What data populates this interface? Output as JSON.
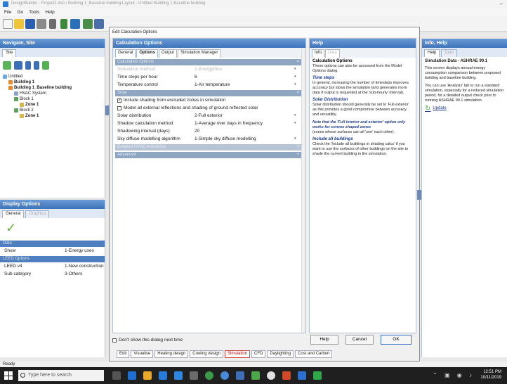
{
  "window": {
    "title": "DesignBuilder - Project1.dsb / Building 1_Baseline building Layout - Untitled Building 1 Baseline building"
  },
  "menu": [
    "File",
    "Go",
    "Tools",
    "Help"
  ],
  "navigate": {
    "title": "Navigate, Site",
    "tab": "Site",
    "tree": [
      {
        "label": "Untitled",
        "level": 0,
        "bold": false
      },
      {
        "label": "Building 1",
        "level": 1,
        "bold": true
      },
      {
        "label": "Building 1_Baseline building",
        "level": 1,
        "bold": true
      },
      {
        "label": "HVAC System",
        "level": 2,
        "bold": false
      },
      {
        "label": "Block 1",
        "level": 2,
        "bold": false
      },
      {
        "label": "Zone 1",
        "level": 3,
        "bold": true
      },
      {
        "label": "Block 2",
        "level": 2,
        "bold": false
      },
      {
        "label": "Zone 1",
        "level": 3,
        "bold": true
      }
    ]
  },
  "display": {
    "title": "Display Options",
    "tabs": [
      "General",
      "Graphics"
    ],
    "sections": [
      {
        "header": "Data",
        "rows": [
          {
            "key": "Show",
            "value": "1-Energy uses"
          }
        ]
      },
      {
        "header": "LEED Options",
        "rows": [
          {
            "key": "LEED v4",
            "value": "1-New construction"
          },
          {
            "key": "Sub category",
            "value": "3-Others"
          }
        ]
      }
    ]
  },
  "dialog": {
    "title": "Edit Calculation Options",
    "panel_title": "Calculation Options",
    "tabs": [
      "General",
      "Options",
      "Output",
      "Simulation Manager"
    ],
    "groups": [
      {
        "name": "Calculation Options",
        "rows": [
          {
            "key": "Simulation method",
            "value": "1-EnergyPlus",
            "disabled": true
          },
          {
            "key": "Time steps per hour",
            "value": "6",
            "disabled": false
          },
          {
            "key": "Temperature control",
            "value": "1-Air temperature",
            "disabled": false
          }
        ]
      },
      {
        "name": "Solar",
        "checks": [
          {
            "label": "Include shading from excluded zones in simulation",
            "checked": true
          },
          {
            "label": "Model all external reflections and shading of ground reflected solar",
            "checked": false
          }
        ],
        "rows": [
          {
            "key": "Solar distribution",
            "value": "2-Full exterior",
            "disabled": false
          },
          {
            "key": "Shadow calculation method",
            "value": "1-Average over days in frequency",
            "disabled": false
          },
          {
            "key": "Shadowing interval (days)",
            "value": "20",
            "disabled": false
          },
          {
            "key": "Sky diffuse modelling algorithm",
            "value": "1-Simple sky diffuse modelling",
            "disabled": false
          }
        ]
      },
      {
        "name": "Detailed HVAC Autosizing",
        "rows": []
      },
      {
        "name": "Advanced",
        "rows": []
      }
    ],
    "dont_show": "Don't show this dialog next time",
    "buttons": {
      "help": "Help",
      "cancel": "Cancel",
      "ok": "OK"
    }
  },
  "help": {
    "title": "Help",
    "tabs": [
      "Info",
      "Data"
    ],
    "heading": "Calculation Options",
    "intro": "These options can also be accessed from the Model Options dialog.",
    "sections": [
      {
        "h": "Time steps",
        "t": "In general, increasing the number of timesteps improves accuracy but slows the simulation (and generates more data if output is requested at the 'sub-hourly' interval)."
      },
      {
        "h": "Solar Distribution",
        "t": "Solar distribution should generally be set to 'Full exterior' as this provides a good compromise between accuracy and versatility."
      }
    ],
    "note": "Note that the 'Full interior and exterior' option only works for convex shaped zones",
    "note_tail": "(zones whose surfaces can all 'see' each other).",
    "inc_h": "Include all buildings",
    "inc_t": "Check the 'Include all buildings in shading calcs' if you want to use the surfaces of other buildings on the site to shade the current building in the simulation."
  },
  "info": {
    "title": "Info, Help",
    "tabs": [
      "Help",
      "Data"
    ],
    "heading": "Simulation Data - ASHRAE 90.1",
    "p1": "This screen displays annual energy consumption comparison between proposed building and baseline building.",
    "p2": "You can use 'Analysis' tab to run a standard simulation, especially for a reduced simulation period, for a detailed output check prior to running ASHRAE 90.1 simulation.",
    "update": "Update"
  },
  "bottom_tabs": [
    "Edit",
    "Visualise",
    "Heating design",
    "Cooling design",
    "Simulation",
    "CFD",
    "Daylighting",
    "Cost and Carbon"
  ],
  "bottom_active": "Simulation",
  "status": "Ready",
  "taskbar": {
    "search_placeholder": "Type here to search",
    "time": "12:51 PM",
    "date": "10/11/2019"
  }
}
